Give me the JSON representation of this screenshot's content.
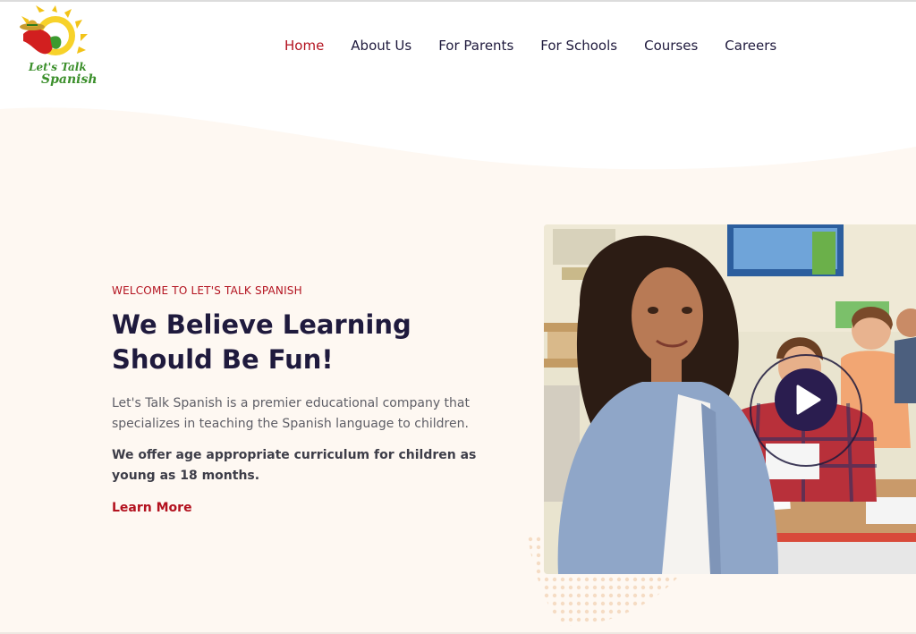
{
  "logo": {
    "line1": "Let's Talk",
    "line2": "Spanish"
  },
  "nav": {
    "items": [
      {
        "label": "Home",
        "active": true
      },
      {
        "label": "About Us",
        "active": false
      },
      {
        "label": "For Parents",
        "active": false
      },
      {
        "label": "For Schools",
        "active": false
      },
      {
        "label": "Courses",
        "active": false
      },
      {
        "label": "Careers",
        "active": false
      }
    ]
  },
  "hero": {
    "eyebrow": "WELCOME TO LET'S TALK SPANISH",
    "title": "We Believe Learning Should Be Fun!",
    "paragraph1": "Let's Talk Spanish is a premier educational company that specializes in teaching the Spanish language to children.",
    "paragraph2": "We offer age appropriate curriculum for children as young as 18 months.",
    "cta": "Learn More"
  },
  "colors": {
    "accent": "#b3121f",
    "navy": "#1f1a3d",
    "hero_bg": "#fef8f2",
    "play_button": "#2a1d4f"
  },
  "icons": {
    "play": "play-icon",
    "logo": "pepper-sun-logo"
  }
}
